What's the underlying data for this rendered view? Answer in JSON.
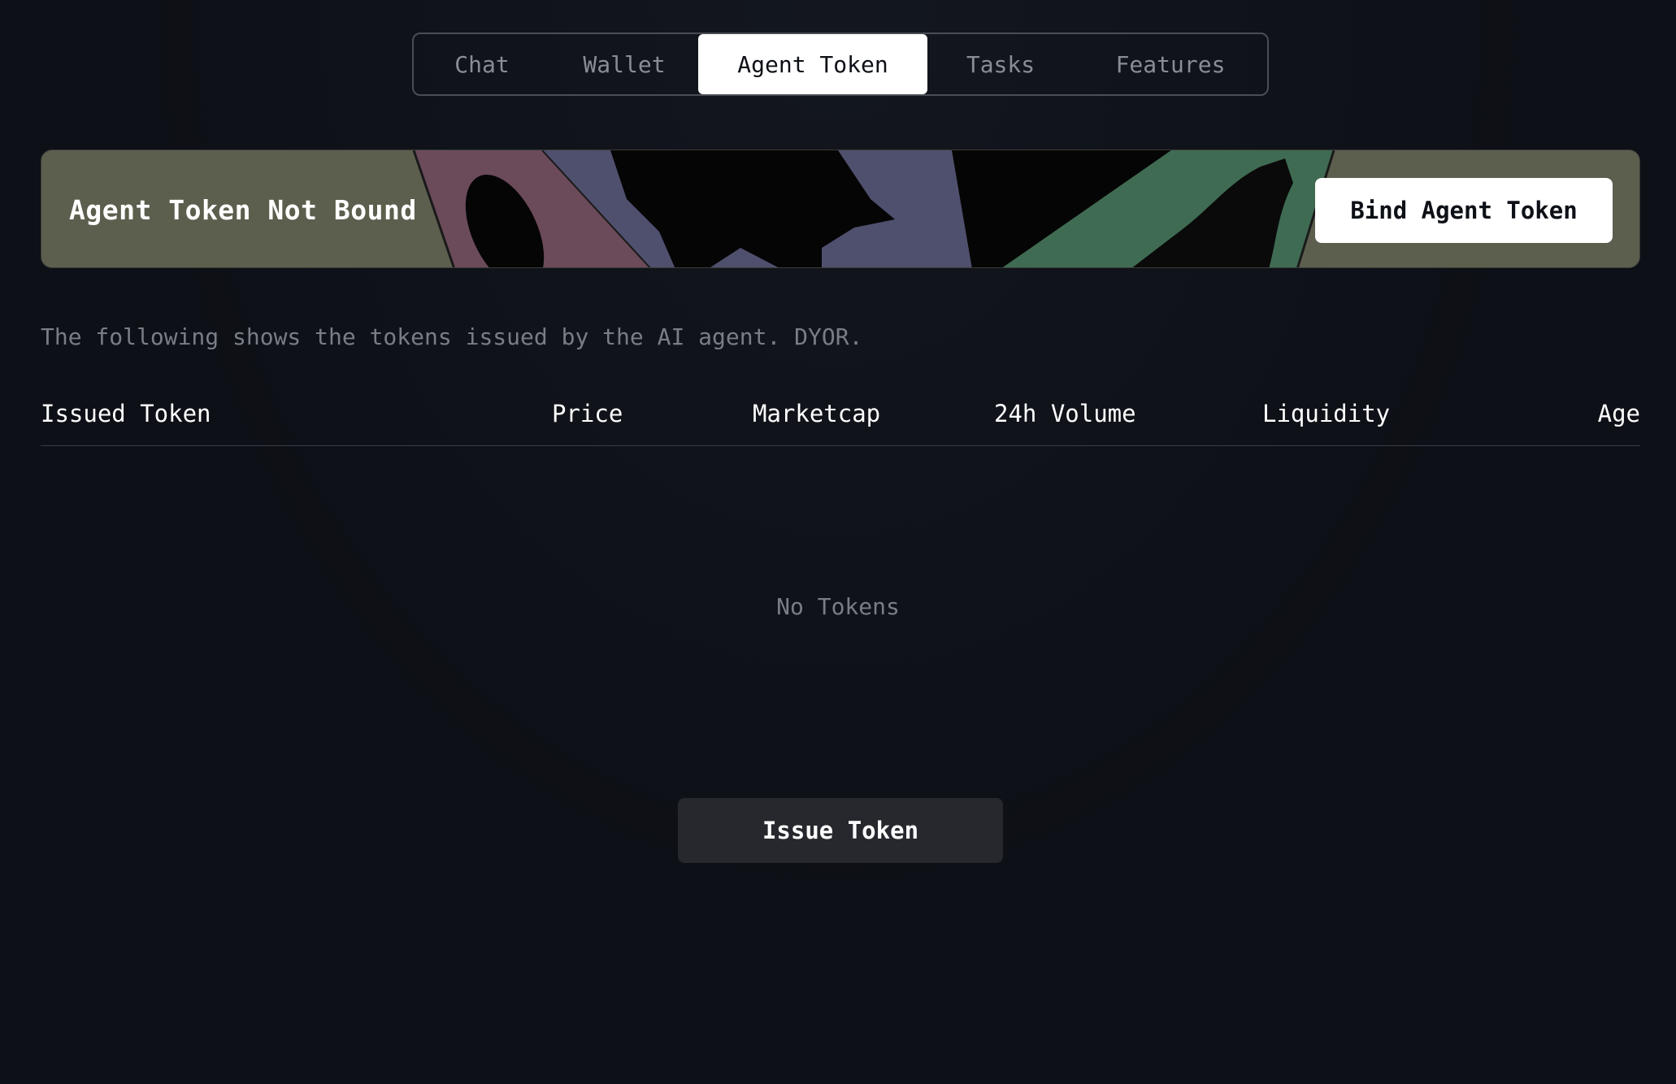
{
  "tabs": [
    {
      "label": "Chat",
      "active": false
    },
    {
      "label": "Wallet",
      "active": false
    },
    {
      "label": "Agent Token",
      "active": true
    },
    {
      "label": "Tasks",
      "active": false
    },
    {
      "label": "Features",
      "active": false
    }
  ],
  "banner": {
    "title": "Agent Token Not Bound",
    "button_label": "Bind Agent Token"
  },
  "description": "The following shows the tokens issued by the AI agent. DYOR.",
  "table": {
    "columns": [
      "Issued Token",
      "Price",
      "Marketcap",
      "24h Volume",
      "Liquidity",
      "Age"
    ],
    "rows": [],
    "empty_text": "No Tokens"
  },
  "issue_button_label": "Issue Token",
  "colors": {
    "background": "#0d1016",
    "banner_base": "#5c5f4e",
    "banner_pink": "#6b4a5a",
    "banner_purple": "#4f4f6e",
    "banner_green": "#3f6b52",
    "active_tab": "#ffffff",
    "issue_button": "#26282d"
  }
}
